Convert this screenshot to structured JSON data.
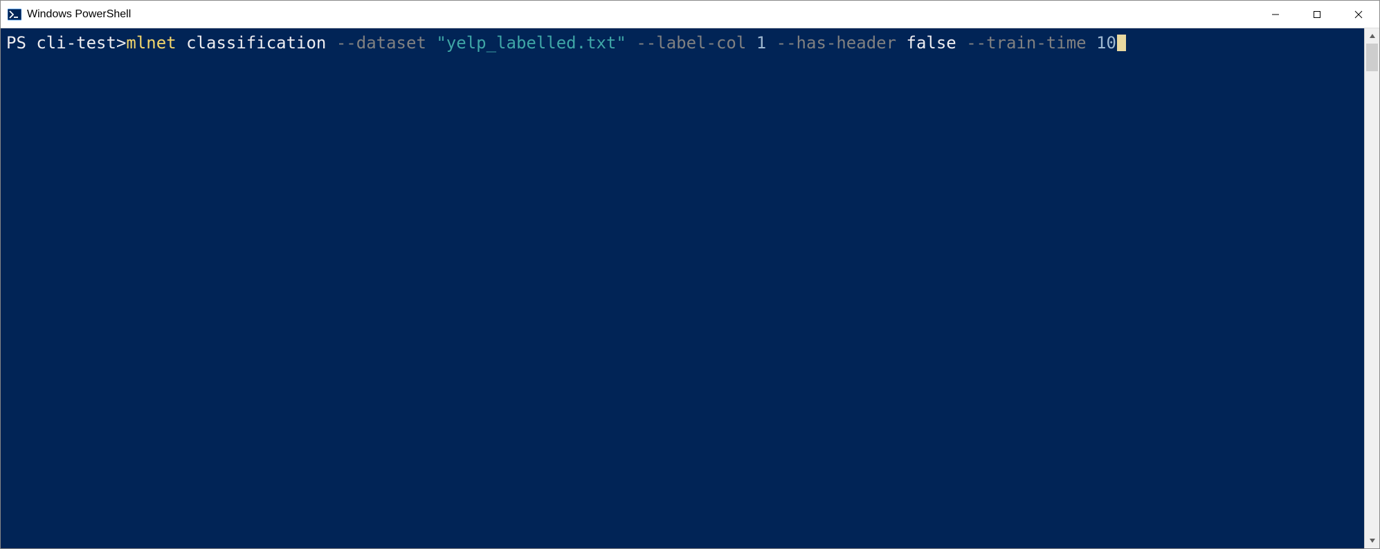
{
  "window": {
    "title": "Windows PowerShell"
  },
  "terminal": {
    "prompt": "PS cli-test>",
    "command": "mlnet",
    "subcommand": "classification",
    "flag_dataset": "--dataset",
    "val_dataset": "\"yelp_labelled.txt\"",
    "flag_labelcol": "--label-col",
    "val_labelcol": "1",
    "flag_hasheader": "--has-header",
    "val_hasheader": "false",
    "flag_traintime": "--train-time",
    "val_traintime": "10"
  }
}
